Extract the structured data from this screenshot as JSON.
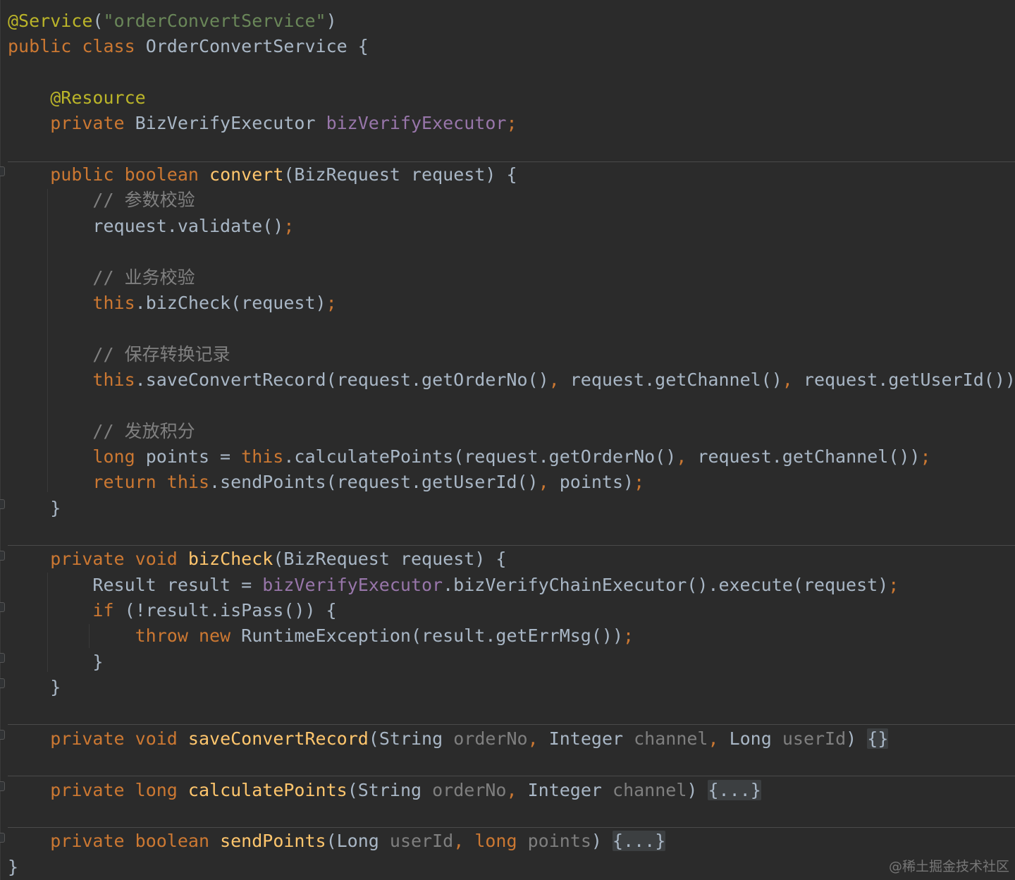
{
  "code": {
    "lines": [
      [
        [
          "ann",
          "@Service"
        ],
        [
          "plain",
          "("
        ],
        [
          "str",
          "\"orderConvertService\""
        ],
        [
          "plain",
          ")"
        ]
      ],
      [
        [
          "kw",
          "public"
        ],
        [
          "plain",
          " "
        ],
        [
          "kw",
          "class"
        ],
        [
          "plain",
          " OrderConvertService {"
        ]
      ],
      [],
      [
        [
          "plain",
          "    "
        ],
        [
          "ann",
          "@Resource"
        ]
      ],
      [
        [
          "plain",
          "    "
        ],
        [
          "kw",
          "private"
        ],
        [
          "plain",
          " BizVerifyExecutor "
        ],
        [
          "field",
          "bizVerifyExecutor"
        ],
        [
          "kw",
          ";"
        ]
      ],
      [],
      [
        [
          "plain",
          "    "
        ],
        [
          "kw",
          "public"
        ],
        [
          "plain",
          " "
        ],
        [
          "kw",
          "boolean"
        ],
        [
          "plain",
          " "
        ],
        [
          "fn",
          "convert"
        ],
        [
          "plain",
          "(BizRequest request) {"
        ]
      ],
      [
        [
          "plain",
          "        "
        ],
        [
          "cmt",
          "// 参数校验"
        ]
      ],
      [
        [
          "plain",
          "        request.validate()"
        ],
        [
          "kw",
          ";"
        ]
      ],
      [],
      [
        [
          "plain",
          "        "
        ],
        [
          "cmt",
          "// 业务校验"
        ]
      ],
      [
        [
          "plain",
          "        "
        ],
        [
          "kw",
          "this"
        ],
        [
          "plain",
          ".bizCheck(request)"
        ],
        [
          "kw",
          ";"
        ]
      ],
      [],
      [
        [
          "plain",
          "        "
        ],
        [
          "cmt",
          "// 保存转换记录"
        ]
      ],
      [
        [
          "plain",
          "        "
        ],
        [
          "kw",
          "this"
        ],
        [
          "plain",
          ".saveConvertRecord(request.getOrderNo()"
        ],
        [
          "kw",
          ","
        ],
        [
          "plain",
          " request.getChannel()"
        ],
        [
          "kw",
          ","
        ],
        [
          "plain",
          " request.getUserId())"
        ],
        [
          "kw",
          ";"
        ]
      ],
      [],
      [
        [
          "plain",
          "        "
        ],
        [
          "cmt",
          "// 发放积分"
        ]
      ],
      [
        [
          "plain",
          "        "
        ],
        [
          "kw",
          "long"
        ],
        [
          "plain",
          " points = "
        ],
        [
          "kw",
          "this"
        ],
        [
          "plain",
          ".calculatePoints(request.getOrderNo()"
        ],
        [
          "kw",
          ","
        ],
        [
          "plain",
          " request.getChannel())"
        ],
        [
          "kw",
          ";"
        ]
      ],
      [
        [
          "plain",
          "        "
        ],
        [
          "kw",
          "return"
        ],
        [
          "plain",
          " "
        ],
        [
          "kw",
          "this"
        ],
        [
          "plain",
          ".sendPoints(request.getUserId()"
        ],
        [
          "kw",
          ","
        ],
        [
          "plain",
          " points)"
        ],
        [
          "kw",
          ";"
        ]
      ],
      [
        [
          "plain",
          "    }"
        ]
      ],
      [],
      [
        [
          "plain",
          "    "
        ],
        [
          "kw",
          "private"
        ],
        [
          "plain",
          " "
        ],
        [
          "kw",
          "void"
        ],
        [
          "plain",
          " "
        ],
        [
          "fn",
          "bizCheck"
        ],
        [
          "plain",
          "(BizRequest request) {"
        ]
      ],
      [
        [
          "plain",
          "        Result result = "
        ],
        [
          "field",
          "bizVerifyExecutor"
        ],
        [
          "plain",
          ".bizVerifyChainExecutor().execute(request)"
        ],
        [
          "kw",
          ";"
        ]
      ],
      [
        [
          "plain",
          "        "
        ],
        [
          "kw",
          "if"
        ],
        [
          "plain",
          " (!result.isPass()) {"
        ]
      ],
      [
        [
          "plain",
          "            "
        ],
        [
          "kw",
          "throw"
        ],
        [
          "plain",
          " "
        ],
        [
          "kw",
          "new"
        ],
        [
          "plain",
          " RuntimeException(result.getErrMsg())"
        ],
        [
          "kw",
          ";"
        ]
      ],
      [
        [
          "plain",
          "        }"
        ]
      ],
      [
        [
          "plain",
          "    }"
        ]
      ],
      [],
      [
        [
          "plain",
          "    "
        ],
        [
          "kw",
          "private"
        ],
        [
          "plain",
          " "
        ],
        [
          "kw",
          "void"
        ],
        [
          "plain",
          " "
        ],
        [
          "fn",
          "saveConvertRecord"
        ],
        [
          "plain",
          "(String "
        ],
        [
          "param",
          "orderNo"
        ],
        [
          "kw",
          ","
        ],
        [
          "plain",
          " Integer "
        ],
        [
          "param",
          "channel"
        ],
        [
          "kw",
          ","
        ],
        [
          "plain",
          " Long "
        ],
        [
          "param",
          "userId"
        ],
        [
          "plain",
          ") "
        ],
        [
          "fold",
          "{}"
        ]
      ],
      [],
      [
        [
          "plain",
          "    "
        ],
        [
          "kw",
          "private"
        ],
        [
          "plain",
          " "
        ],
        [
          "kw",
          "long"
        ],
        [
          "plain",
          " "
        ],
        [
          "fn",
          "calculatePoints"
        ],
        [
          "plain",
          "(String "
        ],
        [
          "param",
          "orderNo"
        ],
        [
          "kw",
          ","
        ],
        [
          "plain",
          " Integer "
        ],
        [
          "param",
          "channel"
        ],
        [
          "plain",
          ") "
        ],
        [
          "fold",
          "{...}"
        ]
      ],
      [],
      [
        [
          "plain",
          "    "
        ],
        [
          "kw",
          "private"
        ],
        [
          "plain",
          " "
        ],
        [
          "kw",
          "boolean"
        ],
        [
          "plain",
          " "
        ],
        [
          "fn",
          "sendPoints"
        ],
        [
          "plain",
          "(Long "
        ],
        [
          "param",
          "userId"
        ],
        [
          "kw",
          ","
        ],
        [
          "plain",
          " "
        ],
        [
          "kw",
          "long"
        ],
        [
          "plain",
          " "
        ],
        [
          "param",
          "points"
        ],
        [
          "plain",
          ") "
        ],
        [
          "fold",
          "{...}"
        ]
      ],
      [
        [
          "plain",
          "}"
        ]
      ]
    ]
  },
  "watermark": "@稀土掘金技术社区"
}
